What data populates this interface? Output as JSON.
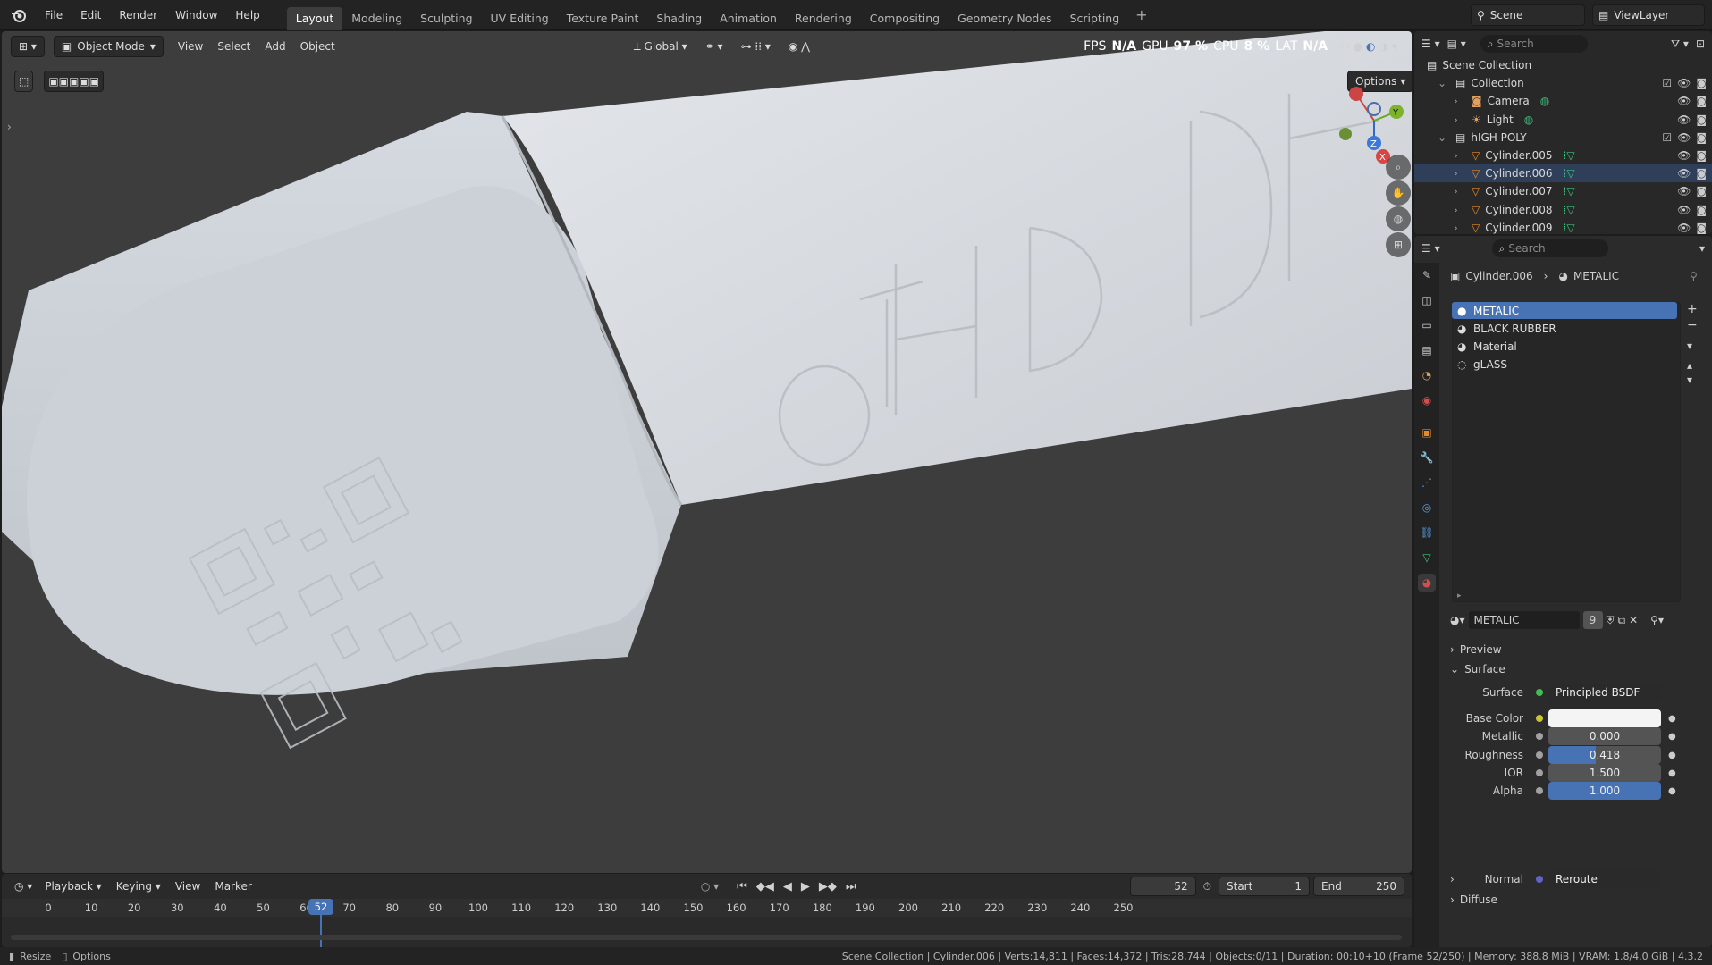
{
  "menubar": {
    "items": [
      "File",
      "Edit",
      "Render",
      "Window",
      "Help"
    ],
    "workspaces": [
      "Layout",
      "Modeling",
      "Sculpting",
      "UV Editing",
      "Texture Paint",
      "Shading",
      "Animation",
      "Rendering",
      "Compositing",
      "Geometry Nodes",
      "Scripting"
    ],
    "active_workspace": "Layout",
    "scene": "Scene",
    "view_layer": "ViewLayer"
  },
  "viewport": {
    "mode": "Object Mode",
    "menus": [
      "View",
      "Select",
      "Add",
      "Object"
    ],
    "orientation": "Global",
    "options_label": "Options",
    "overlay_stats": {
      "fps_label": "FPS",
      "fps": "N/A",
      "gpu_label": "GPU",
      "gpu": "97 %",
      "cpu_label": "CPU",
      "cpu": "8 %",
      "lat_label": "LAT",
      "lat": "N/A"
    },
    "gizmo_axes": [
      "Y",
      "Z",
      "X"
    ]
  },
  "timeline": {
    "menus": [
      "Playback",
      "Keying",
      "View",
      "Marker"
    ],
    "current_frame": "52",
    "start_label": "Start",
    "start": "1",
    "end_label": "End",
    "end": "250",
    "ticks": [
      0,
      10,
      20,
      30,
      40,
      50,
      60,
      70,
      80,
      90,
      100,
      110,
      120,
      130,
      140,
      150,
      160,
      170,
      180,
      190,
      200,
      210,
      220,
      230,
      240,
      250
    ],
    "playhead_label": "52"
  },
  "statusbar": {
    "left_items": [
      "Resize",
      "Options"
    ],
    "info": "Scene Collection | Cylinder.006 | Verts:14,811 | Faces:14,372 | Tris:28,744 | Objects:0/11 | Duration: 00:10+10 (Frame 52/250) | Memory: 388.8 MiB | VRAM: 1.8/4.0 GiB | 4.3.2"
  },
  "outliner": {
    "search_placeholder": "Search",
    "rows": [
      {
        "label": "Scene Collection",
        "indent": 0
      },
      {
        "label": "Collection",
        "indent": 1
      },
      {
        "label": "Camera",
        "indent": 2
      },
      {
        "label": "Light",
        "indent": 2
      },
      {
        "label": "hIGH POLY",
        "indent": 1
      },
      {
        "label": "Cylinder.005",
        "indent": 2
      },
      {
        "label": "Cylinder.006",
        "indent": 2
      },
      {
        "label": "Cylinder.007",
        "indent": 2
      },
      {
        "label": "Cylinder.008",
        "indent": 2
      },
      {
        "label": "Cylinder.009",
        "indent": 2
      }
    ]
  },
  "properties": {
    "search_placeholder": "Search",
    "breadcrumb_object": "Cylinder.006",
    "breadcrumb_material": "METALIC",
    "slots": [
      "METALIC",
      "BLACK RUBBER",
      "Material",
      "gLASS"
    ],
    "active_slot": "METALIC",
    "material_name": "METALIC",
    "user_count": "9",
    "panels": {
      "preview": "Preview",
      "surface": "Surface",
      "diffuse": "Diffuse"
    },
    "surface_label": "Surface",
    "surface_value": "Principled BSDF",
    "fields": [
      {
        "label": "Base Color",
        "value": "",
        "fill": 1.0,
        "color": "#f4f4f4",
        "socket": "#c7c729"
      },
      {
        "label": "Metallic",
        "value": "0.000",
        "fill": 0.0,
        "color": "#4772b3",
        "socket": "#a1a1a1"
      },
      {
        "label": "Roughness",
        "value": "0.418",
        "fill": 0.418,
        "color": "#4772b3",
        "socket": "#a1a1a1"
      },
      {
        "label": "IOR",
        "value": "1.500",
        "fill": 0.0,
        "color": "#4772b3",
        "socket": "#a1a1a1"
      },
      {
        "label": "Alpha",
        "value": "1.000",
        "fill": 1.0,
        "color": "#4772b3",
        "socket": "#a1a1a1"
      }
    ],
    "normal_label": "Normal",
    "normal_value": "Reroute"
  },
  "colors": {
    "accent": "#4772b3",
    "bg": "#3d3d3d",
    "panel": "#2b2b2b"
  }
}
